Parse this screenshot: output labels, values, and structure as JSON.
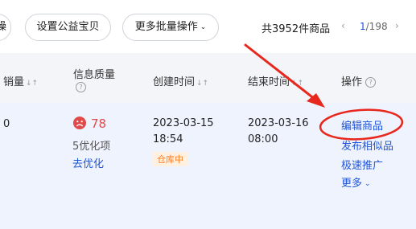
{
  "toolbar": {
    "partial_button_label": "操",
    "charity_button_label": "设置公益宝贝",
    "batch_button_label": "更多批量操作",
    "total_text": "共3952件商品",
    "prev_icon": "chevron-left-icon",
    "next_icon": "chevron-right-icon",
    "page_current": "1",
    "page_total": "/198"
  },
  "table": {
    "headers": {
      "sales": "销量",
      "quality": "信息质量",
      "created": "创建时间",
      "end": "结束时间",
      "actions": "操作"
    },
    "row": {
      "sales": "0",
      "quality_score": "78",
      "quality_icon": "sad-face-icon",
      "optimize_count": "5优化项",
      "optimize_link": "去优化",
      "created_date": "2023-03-15",
      "created_time": "18:54",
      "status_tag": "仓库中",
      "end_date": "2023-03-16",
      "end_time": "08:00",
      "actions": {
        "edit": "编辑商品",
        "publish_similar": "发布相似品",
        "promote": "极速推广",
        "more": "更多"
      }
    }
  },
  "colors": {
    "link": "#1f54d6",
    "score_red": "#e14a4a",
    "annotation_red": "#e8281e",
    "tag_orange": "#ff7a1a",
    "row_highlight": "#eff3fe"
  }
}
